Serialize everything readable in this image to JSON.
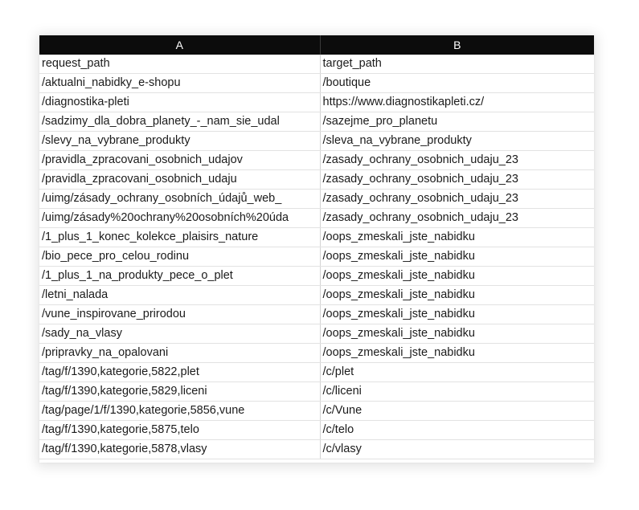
{
  "columns": [
    "A",
    "B"
  ],
  "rows": [
    [
      "request_path",
      "target_path"
    ],
    [
      "/aktualni_nabidky_e-shopu",
      "/boutique"
    ],
    [
      "/diagnostika-pleti",
      "https://www.diagnostikapleti.cz/"
    ],
    [
      "/sadzimy_dla_dobra_planety_-_nam_sie_udal",
      "/sazejme_pro_planetu"
    ],
    [
      "/slevy_na_vybrane_produkty",
      "/sleva_na_vybrane_produkty"
    ],
    [
      "/pravidla_zpracovani_osobnich_udajov",
      "/zasady_ochrany_osobnich_udaju_23"
    ],
    [
      "/pravidla_zpracovani_osobnich_udaju",
      "/zasady_ochrany_osobnich_udaju_23"
    ],
    [
      "/uimg/zásady_ochrany_osobních_údajů_web_",
      "/zasady_ochrany_osobnich_udaju_23"
    ],
    [
      "/uimg/zásady%20ochrany%20osobních%20úda",
      "/zasady_ochrany_osobnich_udaju_23"
    ],
    [
      "/1_plus_1_konec_kolekce_plaisirs_nature",
      "/oops_zmeskali_jste_nabidku"
    ],
    [
      "/bio_pece_pro_celou_rodinu",
      "/oops_zmeskali_jste_nabidku"
    ],
    [
      "/1_plus_1_na_produkty_pece_o_plet",
      "/oops_zmeskali_jste_nabidku"
    ],
    [
      "/letni_nalada",
      "/oops_zmeskali_jste_nabidku"
    ],
    [
      "/vune_inspirovane_prirodou",
      "/oops_zmeskali_jste_nabidku"
    ],
    [
      "/sady_na_vlasy",
      "/oops_zmeskali_jste_nabidku"
    ],
    [
      "/pripravky_na_opalovani",
      "/oops_zmeskali_jste_nabidku"
    ],
    [
      "/tag/f/1390,kategorie,5822,plet",
      "/c/plet"
    ],
    [
      "/tag/f/1390,kategorie,5829,liceni",
      "/c/liceni"
    ],
    [
      "/tag/page/1/f/1390,kategorie,5856,vune",
      "/c/Vune"
    ],
    [
      "/tag/f/1390,kategorie,5875,telo",
      "/c/telo"
    ],
    [
      "/tag/f/1390,kategorie,5878,vlasy",
      "/c/vlasy"
    ]
  ]
}
